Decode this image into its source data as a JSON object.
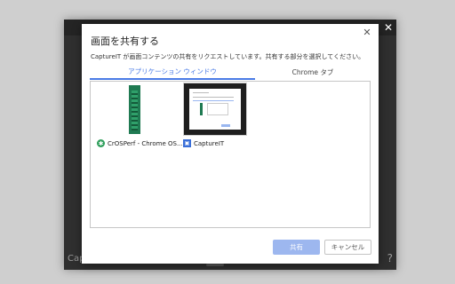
{
  "background_window": {
    "close_glyph": "✕",
    "bottom_left_text": "Captu",
    "bottom_right_text": "?"
  },
  "dialog": {
    "title": "画面を共有する",
    "close_glyph": "✕",
    "description": "CaptureIT が画面コンテンツの共有をリクエストしています。共有する部分を選択してください。",
    "tabs": [
      {
        "label": "アプリケーション ウィンドウ",
        "selected": true
      },
      {
        "label": "Chrome タブ",
        "selected": false
      }
    ],
    "items": [
      {
        "label": "CrOSPerf - Chrome OS...",
        "icon": "crosperf-app-icon"
      },
      {
        "label": "CaptureIT",
        "icon": "captureit-app-icon"
      }
    ],
    "share_button": "共有",
    "cancel_button": "キャンセル"
  },
  "colors": {
    "accent": "#4a7be6",
    "share_button_disabled": "#9db7ef"
  }
}
